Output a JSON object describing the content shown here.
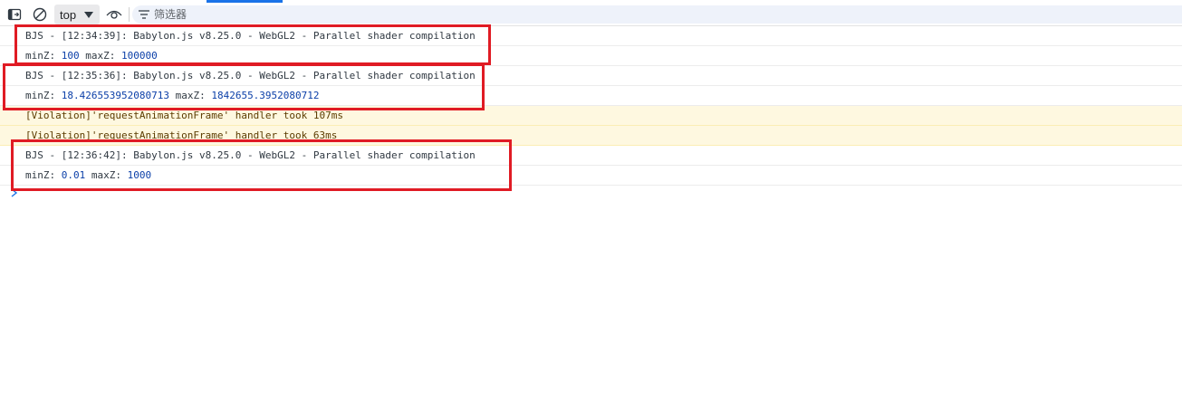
{
  "toolbar": {
    "context_label": "top",
    "filter_placeholder": "筛选器"
  },
  "messages": [
    {
      "kind": "log",
      "text": "BJS - [12:34:39]: Babylon.js v8.25.0 - WebGL2 - Parallel shader compilation"
    },
    {
      "kind": "log",
      "label1": "minZ: ",
      "value1": "100",
      "label2": " maxZ: ",
      "value2": "100000"
    },
    {
      "kind": "log",
      "text": "BJS - [12:35:36]: Babylon.js v8.25.0 - WebGL2 - Parallel shader compilation"
    },
    {
      "kind": "log",
      "label1": "minZ: ",
      "value1": "18.426553952080713",
      "label2": " maxZ: ",
      "value2": "1842655.3952080712"
    },
    {
      "kind": "violation",
      "text": "[Violation]'requestAnimationFrame' handler took 107ms"
    },
    {
      "kind": "violation",
      "text": "[Violation]'requestAnimationFrame' handler took 63ms"
    },
    {
      "kind": "log",
      "text": "BJS - [12:36:42]: Babylon.js v8.25.0 - WebGL2 - Parallel shader compilation"
    },
    {
      "kind": "log",
      "label1": "minZ: ",
      "value1": "0.01",
      "label2": " maxZ: ",
      "value2": "1000"
    }
  ],
  "colors": {
    "highlight": "#e01b24",
    "number": "#0b3fa8",
    "violation_bg": "#fef8e0",
    "accent": "#1a73e8"
  }
}
